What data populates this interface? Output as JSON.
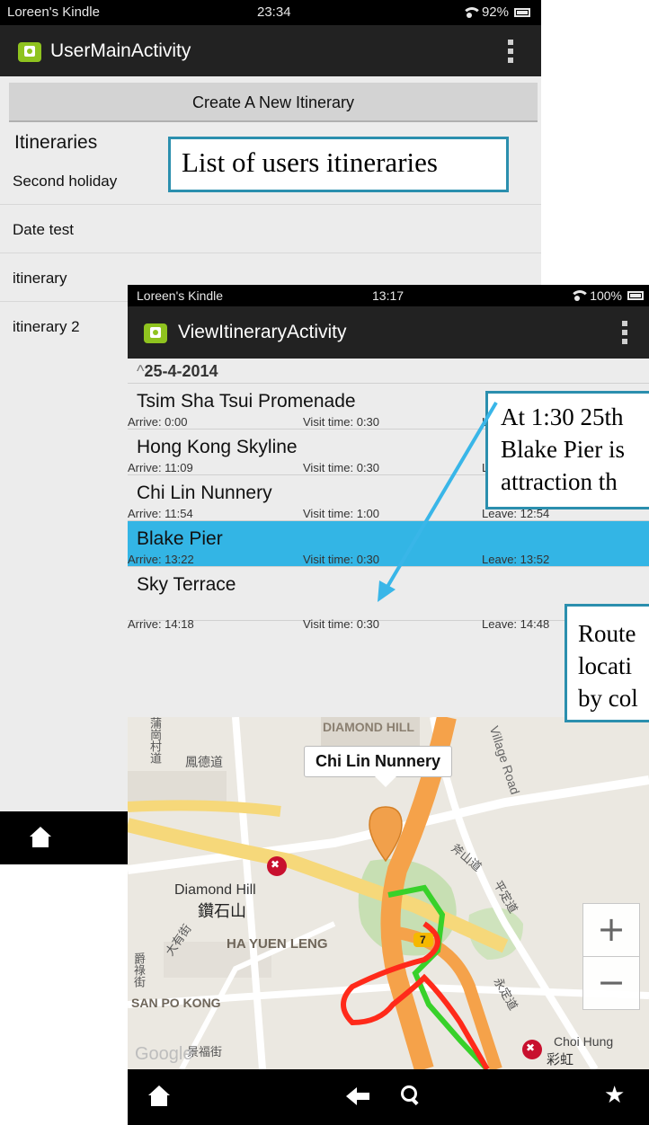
{
  "screen1": {
    "status": {
      "device": "Loreen's Kindle",
      "time": "23:34",
      "battery": "92%"
    },
    "action_bar": {
      "title": "UserMainActivity"
    },
    "create_button": "Create A New Itinerary",
    "list_header": "Itineraries",
    "itineraries": [
      "Second holiday",
      "Date test",
      "itinerary",
      "itinerary 2"
    ]
  },
  "screen2": {
    "status": {
      "device": "Loreen's Kindle",
      "time": "13:17",
      "battery": "100%"
    },
    "action_bar": {
      "title": "ViewItineraryActivity"
    },
    "date": "25-4-2014",
    "stops": [
      {
        "name": "Tsim Sha Tsui Promenade",
        "arrive": "Arrive: 0:00",
        "visit": "Visit time: 0:30",
        "leave": "L"
      },
      {
        "name": "Hong Kong Skyline",
        "arrive": "Arrive: 11:09",
        "visit": "Visit time: 0:30",
        "leave": "L"
      },
      {
        "name": "Chi Lin Nunnery",
        "arrive": "Arrive: 11:54",
        "visit": "Visit time: 1:00",
        "leave": "Leave: 12:54"
      },
      {
        "name": "Blake Pier",
        "arrive": "Arrive: 13:22",
        "visit": "Visit time: 0:30",
        "leave": "Leave: 13:52"
      },
      {
        "name": "Sky Terrace",
        "arrive": "Arrive: 14:18",
        "visit": "Visit time: 0:30",
        "leave": "Leave: 14:48"
      }
    ],
    "map": {
      "marker_label": "Chi Lin Nunnery",
      "places": [
        "DIAMOND HILL",
        "Diamond Hill",
        "鑽石山",
        "HA YUEN LENG",
        "SAN PO KONG",
        "Choi Hung",
        "彩虹",
        "鳳德道",
        "蒲崗村道",
        "大有街",
        "爵祿街",
        "景福街",
        "斧山道",
        "平定道",
        "永定道",
        "Village Road",
        "Google"
      ],
      "route_colors": [
        "#ff2a1a",
        "#38d12a",
        "#f59b2b"
      ]
    },
    "zoom_in": "+",
    "zoom_out": "−"
  },
  "callouts": {
    "list": "List of users itineraries",
    "at": [
      "At 1:30 25th",
      "Blake Pier is",
      "attraction th"
    ],
    "route": [
      "Route",
      "locati",
      "by col"
    ]
  }
}
